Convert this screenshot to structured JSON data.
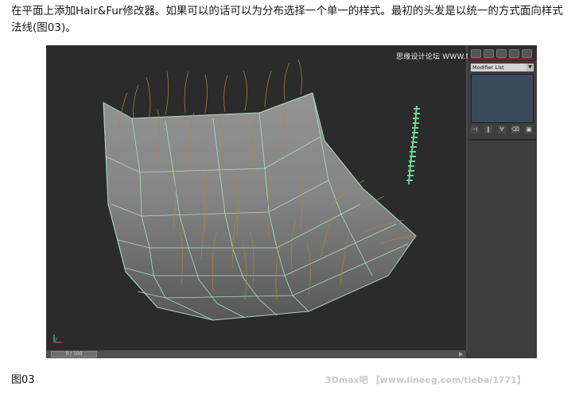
{
  "intro": {
    "text": "在平面上添加Hair&Fur修改器。如果可以的话可以为分布选择一个单一的样式。最初的头发是以统一的方式面向样式法线(图03)。"
  },
  "screenshot": {
    "watermark": "思缘设计论坛 WWW.MISSYUAN.COM",
    "modifier_list": {
      "label": "Modifier List",
      "dropdown_icon": "chevron-down-icon"
    },
    "stack_buttons": [
      {
        "icon": "pin-stack-icon",
        "glyph": "⊣"
      },
      {
        "icon": "show-end-result-icon",
        "glyph": "‖"
      },
      {
        "icon": "make-unique-icon",
        "glyph": "∀"
      },
      {
        "icon": "remove-modifier-icon",
        "glyph": "⌫"
      },
      {
        "icon": "configure-sets-icon",
        "glyph": "▣"
      }
    ],
    "timeline": {
      "frame_label": "0 / 100"
    },
    "colors": {
      "viewport_bg": "#2b2b2b",
      "plane_fill": "#8d8d8d",
      "plane_wire": "#a8e0c0",
      "hair": "#a88a3a",
      "helix": "#6fd39a"
    }
  },
  "caption": "图03",
  "bottom_watermark": "3Dmax吧 【www.lineeg.com/tieba/1771】"
}
